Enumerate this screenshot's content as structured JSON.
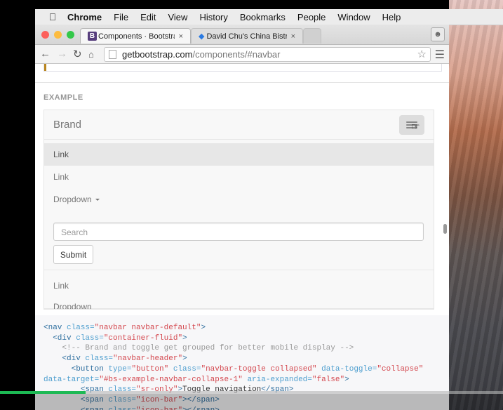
{
  "menubar": {
    "app": "Chrome",
    "items": [
      "File",
      "Edit",
      "View",
      "History",
      "Bookmarks",
      "People",
      "Window",
      "Help"
    ]
  },
  "tabs": [
    {
      "icon": "B",
      "title": "Components · Bootstrap",
      "close": "×"
    },
    {
      "icon": "diamond-icon",
      "title": "David Chu's China Bistro",
      "close": "×"
    }
  ],
  "address": {
    "host": "getbootstrap.com",
    "path": "/components/#navbar"
  },
  "colors": {
    "bootstrap_purple": "#563d7c",
    "code_tag": "#2f6f9f",
    "code_value": "#d44950",
    "progress": "#1db954"
  },
  "example": {
    "label": "EXAMPLE",
    "brand": "Brand",
    "links": [
      "Link",
      "Link",
      "Dropdown",
      "Link",
      "Dropdown"
    ],
    "search_placeholder": "Search",
    "submit": "Submit"
  },
  "code": {
    "lines": [
      [
        {
          "t": "tag",
          "v": "<nav "
        },
        {
          "t": "attr",
          "v": "class="
        },
        {
          "t": "val",
          "v": "\"navbar navbar-default\""
        },
        {
          "t": "tag",
          "v": ">"
        }
      ],
      [
        {
          "t": "",
          "v": "  "
        },
        {
          "t": "tag",
          "v": "<div "
        },
        {
          "t": "attr",
          "v": "class="
        },
        {
          "t": "val",
          "v": "\"container-fluid\""
        },
        {
          "t": "tag",
          "v": ">"
        }
      ],
      [
        {
          "t": "",
          "v": "    "
        },
        {
          "t": "cmt",
          "v": "<!-- Brand and toggle get grouped for better mobile display -->"
        }
      ],
      [
        {
          "t": "",
          "v": "    "
        },
        {
          "t": "tag",
          "v": "<div "
        },
        {
          "t": "attr",
          "v": "class="
        },
        {
          "t": "val",
          "v": "\"navbar-header\""
        },
        {
          "t": "tag",
          "v": ">"
        }
      ],
      [
        {
          "t": "",
          "v": "      "
        },
        {
          "t": "tag",
          "v": "<button "
        },
        {
          "t": "attr",
          "v": "type="
        },
        {
          "t": "val",
          "v": "\"button\" "
        },
        {
          "t": "attr",
          "v": "class="
        },
        {
          "t": "val",
          "v": "\"navbar-toggle collapsed\" "
        },
        {
          "t": "attr",
          "v": "data-toggle="
        },
        {
          "t": "val",
          "v": "\"collapse\""
        }
      ],
      [
        {
          "t": "attr",
          "v": "data-target="
        },
        {
          "t": "val",
          "v": "\"#bs-example-navbar-collapse-1\" "
        },
        {
          "t": "attr",
          "v": "aria-expanded="
        },
        {
          "t": "val",
          "v": "\"false\""
        },
        {
          "t": "tag",
          "v": ">"
        }
      ],
      [
        {
          "t": "",
          "v": "        "
        },
        {
          "t": "tag",
          "v": "<span "
        },
        {
          "t": "attr",
          "v": "class="
        },
        {
          "t": "val",
          "v": "\"sr-only\""
        },
        {
          "t": "tag",
          "v": ">"
        },
        {
          "t": "",
          "v": "Toggle navigation"
        },
        {
          "t": "tag",
          "v": "</span>"
        }
      ],
      [
        {
          "t": "",
          "v": "        "
        },
        {
          "t": "tag",
          "v": "<span "
        },
        {
          "t": "attr",
          "v": "class="
        },
        {
          "t": "val",
          "v": "\"icon-bar\""
        },
        {
          "t": "tag",
          "v": "></span>"
        }
      ],
      [
        {
          "t": "",
          "v": "        "
        },
        {
          "t": "tag",
          "v": "<span "
        },
        {
          "t": "attr",
          "v": "class="
        },
        {
          "t": "val",
          "v": "\"icon-bar\""
        },
        {
          "t": "tag",
          "v": "></span>"
        }
      ]
    ]
  },
  "video_progress": 0.17
}
